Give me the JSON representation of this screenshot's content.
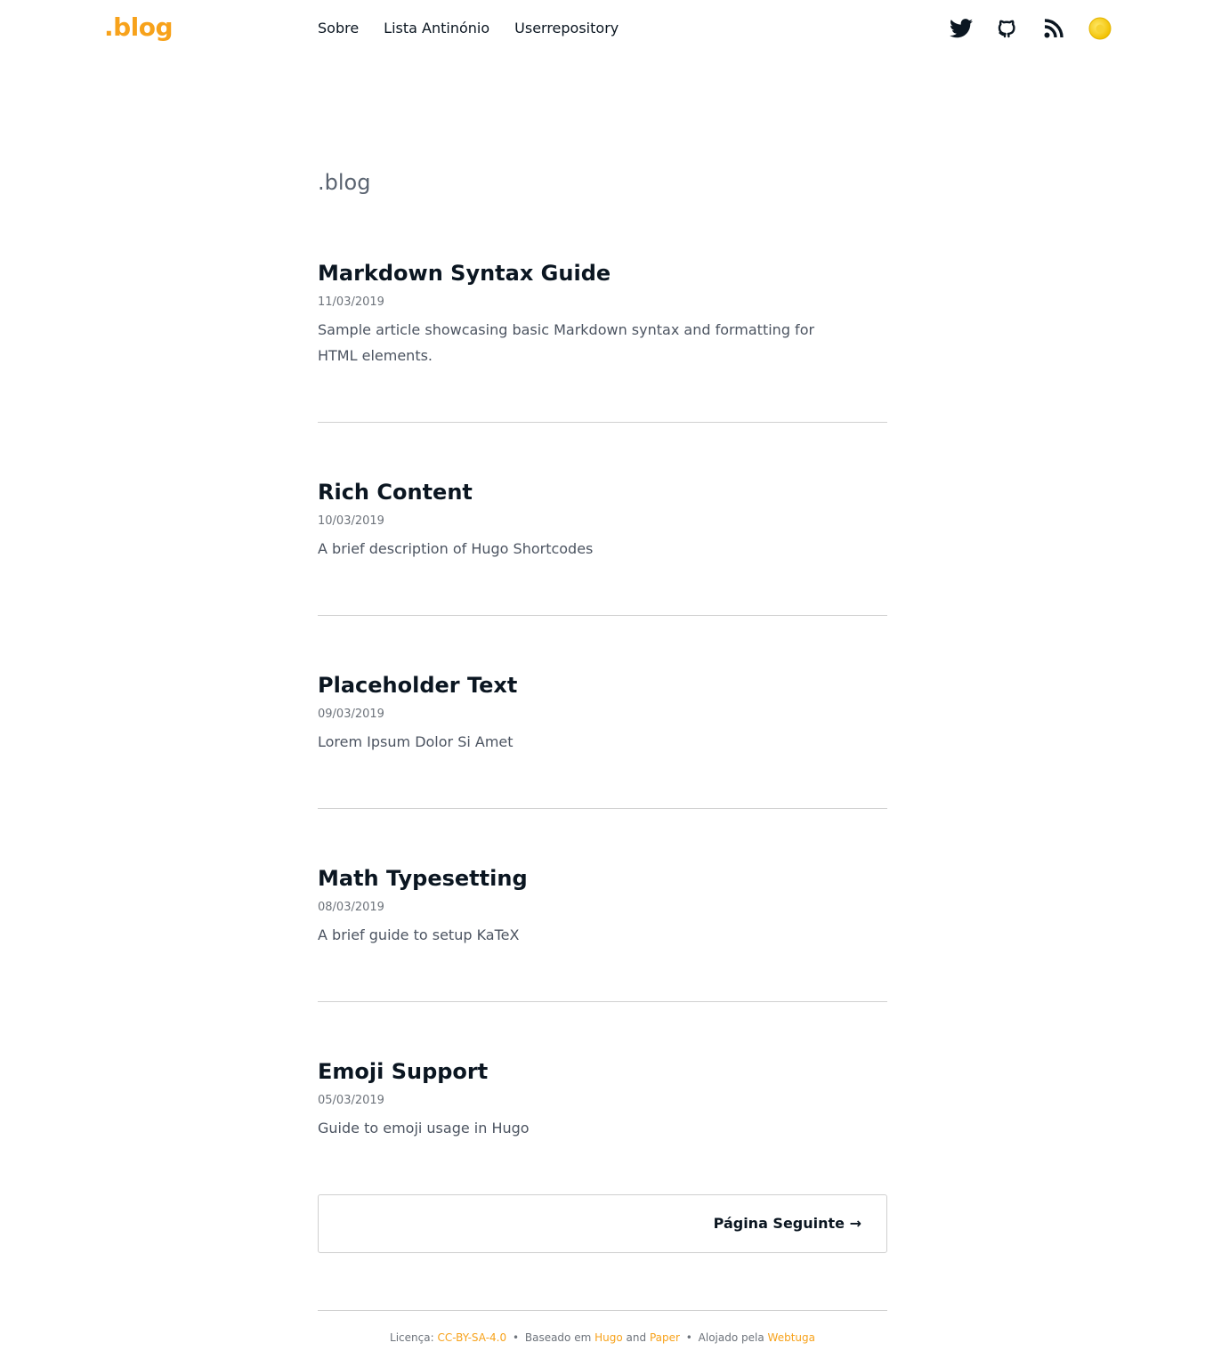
{
  "header": {
    "logo": ".blog",
    "nav": [
      "Sobre",
      "Lista Antinónio",
      "Userrepository"
    ],
    "icons": [
      "twitter-icon",
      "github-icon",
      "rss-icon",
      "theme-toggle-icon"
    ]
  },
  "main": {
    "title": ".blog",
    "posts": [
      {
        "title": "Markdown Syntax Guide",
        "date": "11/03/2019",
        "description": "Sample article showcasing basic Markdown syntax and formatting for HTML elements."
      },
      {
        "title": "Rich Content",
        "date": "10/03/2019",
        "description": "A brief description of Hugo Shortcodes"
      },
      {
        "title": "Placeholder Text",
        "date": "09/03/2019",
        "description": "Lorem Ipsum Dolor Si Amet"
      },
      {
        "title": "Math Typesetting",
        "date": "08/03/2019",
        "description": "A brief guide to setup KaTeX"
      },
      {
        "title": "Emoji Support",
        "date": "05/03/2019",
        "description": "Guide to emoji usage in Hugo"
      }
    ],
    "pagination": {
      "next_label": "Página Seguinte →"
    }
  },
  "footer": {
    "license_label": "Licença:",
    "license_link": "CC-BY-SA-4.0",
    "separator": "•",
    "based_label": "Baseado em",
    "hugo_link": "Hugo",
    "and_label": "and",
    "paper_link": "Paper",
    "hosted_label": "Alojado pela",
    "webtuga_link": "Webtuga"
  },
  "colors": {
    "accent": "#f7a21b",
    "text": "#0b1621",
    "muted": "#6d737b"
  }
}
